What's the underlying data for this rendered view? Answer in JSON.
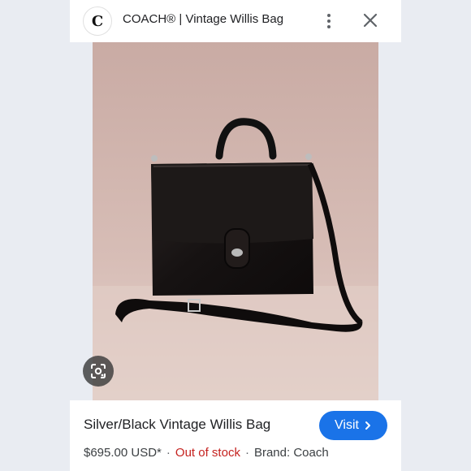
{
  "header": {
    "title": "COACH® | Vintage Willis Bag",
    "logo_letter": "C"
  },
  "icons": {
    "logo": "coach-logo-icon",
    "more": "more-vertical-icon",
    "close": "close-icon",
    "lens": "google-lens-icon",
    "visit_arrow": "chevron-right-icon"
  },
  "product": {
    "name": "Silver/Black Vintage Willis Bag",
    "price": "$695.00 USD*",
    "stock": "Out of stock",
    "brand": "Brand: Coach",
    "separator": "·"
  },
  "actions": {
    "visit_label": "Visit"
  },
  "colors": {
    "accent": "#1a73e8",
    "out_of_stock": "#c5221f"
  }
}
